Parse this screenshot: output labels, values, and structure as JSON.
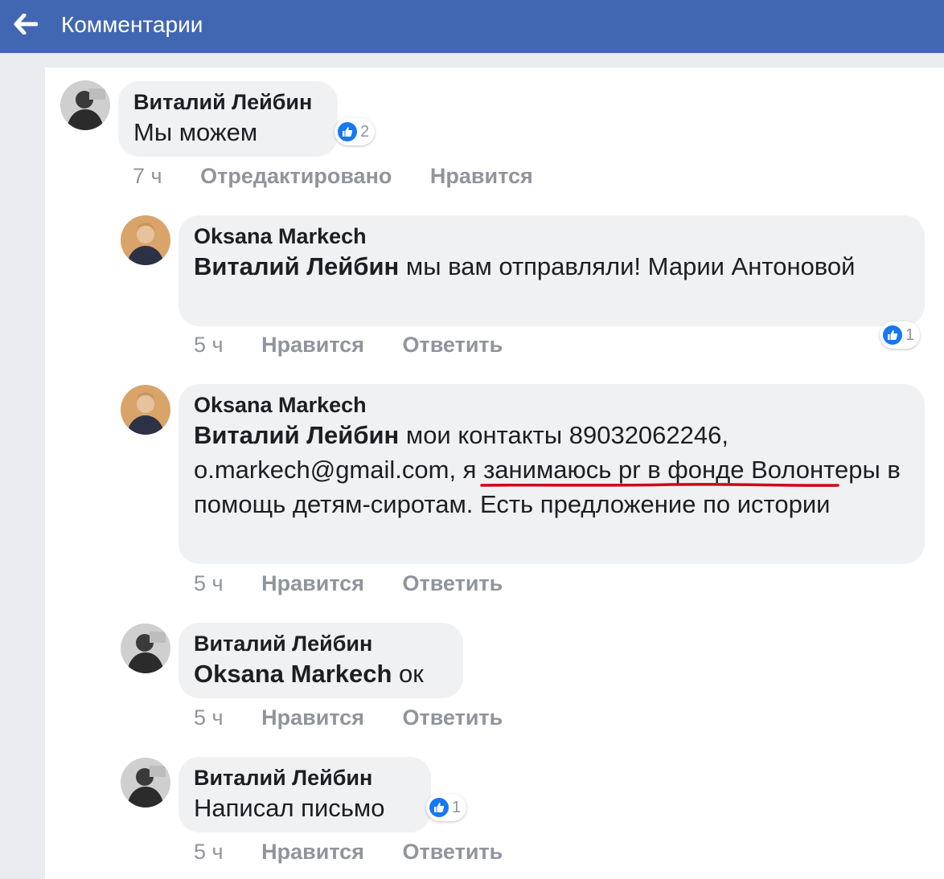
{
  "header": {
    "title": "Комментарии"
  },
  "comments": [
    {
      "author": "Виталий Лейбин",
      "text": "Мы  можем",
      "reactions": "2",
      "meta": {
        "time": "7 ч",
        "action1": "Отредактировано",
        "action2": "Нравится"
      }
    },
    {
      "author": "Oksana Markech",
      "mention": "Виталий Лейбин",
      "text": " мы вам отправляли! Марии Антоновой",
      "reactions": "1",
      "meta": {
        "time": "5 ч",
        "action1": "Нравится",
        "action2": "Ответить"
      }
    },
    {
      "author": "Oksana Markech",
      "mention": "Виталий Лейбин",
      "text_a": " мои контакты 89032062246, o.markech@gmail.com",
      "text_b": ", я занимаюсь pr в фонде",
      "text_c": " Волонтеры в помощь детям-сиротам. Есть предложение по истории",
      "meta": {
        "time": "5 ч",
        "action1": "Нравится",
        "action2": "Ответить"
      }
    },
    {
      "author": "Виталий Лейбин",
      "mention": "Oksana Markech",
      "text": " ок",
      "meta": {
        "time": "5 ч",
        "action1": "Нравится",
        "action2": "Ответить"
      }
    },
    {
      "author": "Виталий Лейбин",
      "text": "Написал письмо",
      "reactions": "1",
      "meta": {
        "time": "5 ч",
        "action1": "Нравится",
        "action2": "Ответить"
      }
    }
  ],
  "icons": {
    "back": "arrow-left-icon",
    "like": "thumbs-up-icon"
  },
  "colors": {
    "header_bg": "#4267b2",
    "bubble_bg": "#f0f1f3",
    "meta_text": "#90949c",
    "like_blue": "#1877f2",
    "annotation_red": "#d0021b"
  }
}
